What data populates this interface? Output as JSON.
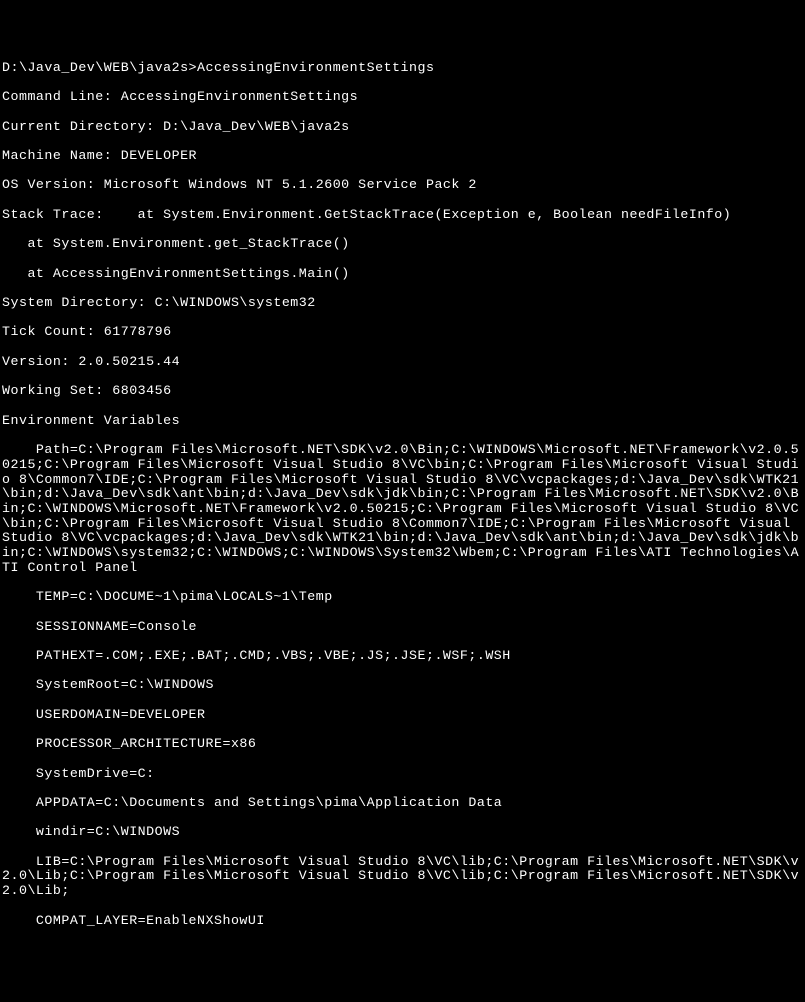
{
  "console": {
    "prompt": "D:\\Java_Dev\\WEB\\java2s>AccessingEnvironmentSettings",
    "command_line": "Command Line: AccessingEnvironmentSettings",
    "current_dir": "Current Directory: D:\\Java_Dev\\WEB\\java2s",
    "machine_name": "Machine Name: DEVELOPER",
    "os_version": "OS Version: Microsoft Windows NT 5.1.2600 Service Pack 2",
    "stack_trace_head": "Stack Trace:    at System.Environment.GetStackTrace(Exception e, Boolean needFileInfo)",
    "stack_trace_1": "   at System.Environment.get_StackTrace()",
    "stack_trace_2": "   at AccessingEnvironmentSettings.Main()",
    "system_dir": "System Directory: C:\\WINDOWS\\system32",
    "tick_count": "Tick Count: 61778796",
    "version": "Version: 2.0.50215.44",
    "working_set": "Working Set: 6803456",
    "env_header": "Environment Variables",
    "env_path": "    Path=C:\\Program Files\\Microsoft.NET\\SDK\\v2.0\\Bin;C:\\WINDOWS\\Microsoft.NET\\Framework\\v2.0.50215;C:\\Program Files\\Microsoft Visual Studio 8\\VC\\bin;C:\\Program Files\\Microsoft Visual Studio 8\\Common7\\IDE;C:\\Program Files\\Microsoft Visual Studio 8\\VC\\vcpackages;d:\\Java_Dev\\sdk\\WTK21\\bin;d:\\Java_Dev\\sdk\\ant\\bin;d:\\Java_Dev\\sdk\\jdk\\bin;C:\\Program Files\\Microsoft.NET\\SDK\\v2.0\\Bin;C:\\WINDOWS\\Microsoft.NET\\Framework\\v2.0.50215;C:\\Program Files\\Microsoft Visual Studio 8\\VC\\bin;C:\\Program Files\\Microsoft Visual Studio 8\\Common7\\IDE;C:\\Program Files\\Microsoft Visual Studio 8\\VC\\vcpackages;d:\\Java_Dev\\sdk\\WTK21\\bin;d:\\Java_Dev\\sdk\\ant\\bin;d:\\Java_Dev\\sdk\\jdk\\bin;C:\\WINDOWS\\system32;C:\\WINDOWS;C:\\WINDOWS\\System32\\Wbem;C:\\Program Files\\ATI Technologies\\ATI Control Panel",
    "env_temp": "    TEMP=C:\\DOCUME~1\\pima\\LOCALS~1\\Temp",
    "env_sessionname": "    SESSIONNAME=Console",
    "env_pathext": "    PATHEXT=.COM;.EXE;.BAT;.CMD;.VBS;.VBE;.JS;.JSE;.WSF;.WSH",
    "env_systemroot": "    SystemRoot=C:\\WINDOWS",
    "env_userdomain": "    USERDOMAIN=DEVELOPER",
    "env_proc_arch": "    PROCESSOR_ARCHITECTURE=x86",
    "env_systemdrive": "    SystemDrive=C:",
    "env_appdata": "    APPDATA=C:\\Documents and Settings\\pima\\Application Data",
    "env_windir": "    windir=C:\\WINDOWS",
    "env_lib": "    LIB=C:\\Program Files\\Microsoft Visual Studio 8\\VC\\lib;C:\\Program Files\\Microsoft.NET\\SDK\\v2.0\\Lib;C:\\Program Files\\Microsoft Visual Studio 8\\VC\\lib;C:\\Program Files\\Microsoft.NET\\SDK\\v2.0\\Lib;",
    "env_compat": "    COMPAT_LAYER=EnableNXShowUI"
  }
}
